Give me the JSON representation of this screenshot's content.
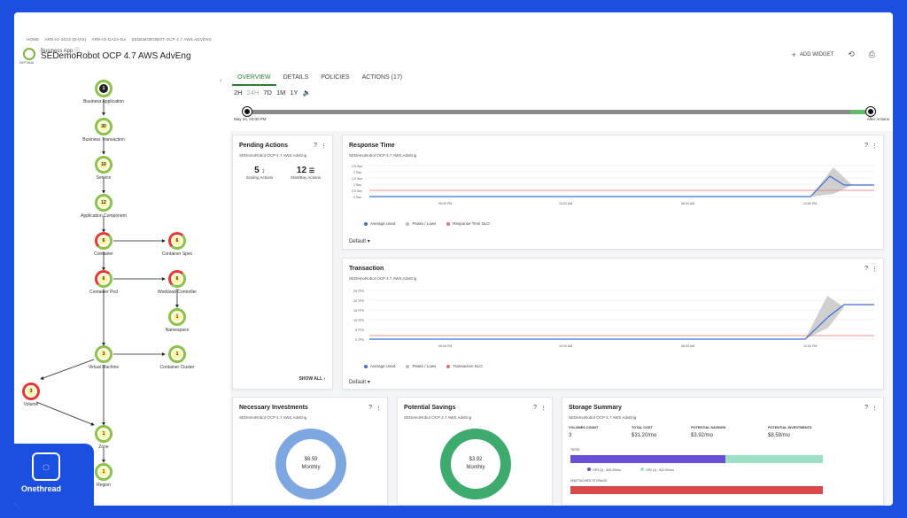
{
  "brand": {
    "name": "Onethread"
  },
  "header": {
    "breadcrumb": [
      "HOME",
      "ARR-IG-2023 (DIVIS)",
      "ARR-IG-DA23-DA",
      "SEDEMOROBOT OCP 4.7 AWS ADVENG"
    ],
    "app_type": "Business App ⓘ",
    "title": "SEDemoRobot OCP 4.7 AWS AdvEng",
    "logo_sub": "DEPTANA",
    "add_widget": "ADD WIDGET"
  },
  "topology": {
    "nodes": [
      {
        "id": "business-application",
        "label": "Business Application",
        "count": "1"
      },
      {
        "id": "business-transaction",
        "label": "Business Transaction",
        "count": "30"
      },
      {
        "id": "service",
        "label": "Service",
        "count": "10"
      },
      {
        "id": "application-component",
        "label": "Application Component",
        "count": "12"
      },
      {
        "id": "container",
        "label": "Container",
        "count": "6"
      },
      {
        "id": "container-spec",
        "label": "Container Spec",
        "count": "6"
      },
      {
        "id": "container-pod",
        "label": "Container Pod",
        "count": "6"
      },
      {
        "id": "workload-controller",
        "label": "Workload Controller",
        "count": "6"
      },
      {
        "id": "namespace",
        "label": "Namespace",
        "count": "1"
      },
      {
        "id": "virtual-machine",
        "label": "Virtual Machine",
        "count": "3"
      },
      {
        "id": "container-cluster",
        "label": "Container Cluster",
        "count": "1"
      },
      {
        "id": "volume",
        "label": "Volume",
        "count": "3"
      },
      {
        "id": "zone",
        "label": "Zone",
        "count": "1"
      },
      {
        "id": "region",
        "label": "Region",
        "count": "1"
      }
    ]
  },
  "tabs": [
    {
      "label": "OVERVIEW",
      "active": true
    },
    {
      "label": "DETAILS",
      "active": false
    },
    {
      "label": "POLICIES",
      "active": false
    },
    {
      "label": "ACTIONS (17)",
      "active": false
    }
  ],
  "time_ranges": [
    "2H",
    "24H",
    "7D",
    "1M",
    "1Y"
  ],
  "timeline": {
    "start_label": "May 24, 03:00 PM",
    "end_label": "After Actions"
  },
  "pending_actions": {
    "title": "Pending Actions",
    "subtitle": "SEDemoRobot OCP 4.7 AWS AdvEng",
    "stats": [
      {
        "value": "5",
        "icon": "scale-icon",
        "label": "Scaling Actions"
      },
      {
        "value": "12",
        "icon": "list-icon",
        "label": "Start/Buy Actions"
      }
    ],
    "show_all": "SHOW ALL"
  },
  "response_time": {
    "title": "Response Time",
    "subtitle": "SEDemoRobot OCP 4.7 AWS AdvEng",
    "y_ticks": [
      "2.5 Sec",
      "2 Sec",
      "1.5 Sec",
      "1 Sec",
      "0.5 Sec",
      "0 Sec"
    ],
    "x_ticks": [
      "06:00 PM",
      "12:00 AM",
      "06:00 AM",
      "12:00 PM"
    ],
    "legend": [
      "Average Used",
      "Peaks / Lows",
      "Response Time SLO"
    ],
    "default_label": "Default"
  },
  "transaction": {
    "title": "Transaction",
    "subtitle": "SEDemoRobot OCP 4.7 AWS AdvEng",
    "y_ticks": [
      "25 TPS",
      "20 TPS",
      "15 TPS",
      "10 TPS",
      "5 TPS",
      "0 TPS"
    ],
    "x_ticks": [
      "06:00 PM",
      "12:00 AM",
      "06:00 AM",
      "12:00 PM"
    ],
    "legend": [
      "Average Used",
      "Peaks / Lows",
      "Transaction SLO"
    ],
    "default_label": "Default"
  },
  "necessary_investments": {
    "title": "Necessary Investments",
    "subtitle": "SEDemoRobot OCP 4.7 AWS AdvEng",
    "amount": "$8.59",
    "period": "Monthly",
    "color": "#7ea6e0"
  },
  "potential_savings": {
    "title": "Potential Savings",
    "subtitle": "SEDemoRobot OCP 4.7 AWS AdvEng",
    "amount": "$3.92",
    "period": "Monthly",
    "color": "#3daa6e"
  },
  "storage_summary": {
    "title": "Storage Summary",
    "subtitle": "SEDemoRobot OCP 4.7 AWS AdvEng",
    "headers": [
      "VOLUMES COUNT",
      "TOTAL COST",
      "POTENTIAL SAVINGS",
      "POTENTIAL INVESTMENTS"
    ],
    "values": [
      "3",
      "$31.20/mo",
      "$3.92/mo",
      "$8.59/mo"
    ],
    "tiers_label": "TIERS",
    "tier_legend": [
      "GP3 (2) - $19.20/mo",
      "GP2 (1) - $12.00/mo"
    ],
    "unattached_label": "UNATTACHED STORAGE",
    "colors": {
      "gp3": "#6a4fd8",
      "gp2": "#9ee0c6",
      "unattached": "#d94a4a"
    }
  }
}
